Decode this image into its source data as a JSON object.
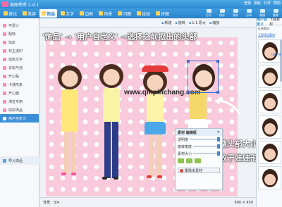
{
  "app": {
    "title": "美图秀秀 2.4.1"
  },
  "top_links": [
    "登录",
    "换肤",
    "分享",
    "帮助"
  ],
  "tabs": [
    {
      "label": "美化",
      "active": false
    },
    {
      "label": "美容",
      "active": false
    },
    {
      "label": "饰品",
      "active": true
    },
    {
      "label": "文字",
      "active": false
    },
    {
      "label": "边框",
      "active": false
    },
    {
      "label": "场景",
      "active": false
    },
    {
      "label": "闪图",
      "active": false
    },
    {
      "label": "娃娃",
      "active": false
    },
    {
      "label": "拼图",
      "active": false
    }
  ],
  "top_actions": [
    "打开",
    "保存",
    "保存",
    "分享",
    "撤销",
    "重做"
  ],
  "sidebar": {
    "items": [
      {
        "label": "可爱心",
        "active": false
      },
      {
        "label": "配饰",
        "active": false
      },
      {
        "label": "炫彩",
        "active": false
      },
      {
        "label": "非主流印",
        "active": false
      },
      {
        "label": "动态文字",
        "active": false
      },
      {
        "label": "论坛气泡",
        "active": false
      },
      {
        "label": "开心贴",
        "active": false
      },
      {
        "label": "卡通形象",
        "active": false
      },
      {
        "label": "开心面",
        "active": false
      },
      {
        "label": "淘宝专用",
        "active": false
      },
      {
        "label": "炫彩饰品",
        "active": false
      },
      {
        "label": "用户自定义",
        "active": true
      }
    ],
    "import_label": "导入饰品"
  },
  "toolbar": {
    "items": [
      "新建",
      "旋转",
      "1:1 原大",
      "缩放"
    ]
  },
  "annotations": {
    "step_text": "'饰品' → '用户自定义' →选择之前抠出的头部",
    "adjust_line1": "调整头部大小",
    "adjust_line2": "置放于娃娃形象上"
  },
  "watermark": "www.qinpinchang.com",
  "property_panel": {
    "title": "素材 编辑框",
    "opacity_label": "透明度",
    "rotate_label": "旋转角度",
    "size_label": "素材大小",
    "delete_label": "删除本素材"
  },
  "status": {
    "left": "背景：3/4",
    "right": "600 × 450"
  },
  "right_panel": {
    "tabs": [
      "用户自定义",
      "下载素材"
    ],
    "filter": "在线素材",
    "link": "立即添加素材",
    "download_link": "下载更多",
    "thumb_count": 8
  },
  "colors": {
    "accent": "#2f8ad1",
    "canvas_bg": "#f8cadb",
    "selection": "#3f6edb"
  }
}
